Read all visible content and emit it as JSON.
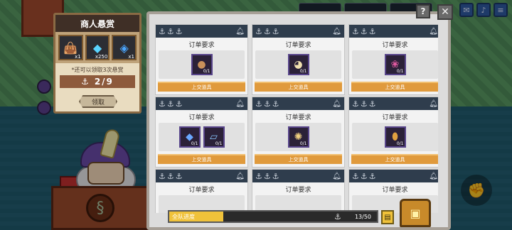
{
  "reward_panel": {
    "title": "商人悬赏",
    "items": [
      {
        "icon": "treasure-bag-icon",
        "count": "x1"
      },
      {
        "icon": "diamond-icon",
        "count": "x250"
      },
      {
        "icon": "blue-gem-icon",
        "count": "x1"
      }
    ],
    "note": "*还可以领取3次悬赏",
    "progress": "2/9",
    "claim_label": "领取"
  },
  "orders": [
    {
      "title": "订单要求",
      "items": [
        {
          "icon": "sack-icon",
          "qty": "0/1"
        }
      ],
      "submit_label": "上交道具"
    },
    {
      "title": "订单要求",
      "items": [
        {
          "icon": "food-bowl-icon",
          "qty": "0/1"
        }
      ],
      "submit_label": "上交道具"
    },
    {
      "title": "订单要求",
      "items": [
        {
          "icon": "fruit-icon",
          "qty": "0/1"
        }
      ],
      "submit_label": "上交道具"
    },
    {
      "title": "订单要求",
      "items": [
        {
          "icon": "blue-crystal-icon",
          "qty": "0/1"
        },
        {
          "icon": "blue-scroll-icon",
          "qty": "0/1"
        }
      ],
      "submit_label": "上交道具"
    },
    {
      "title": "订单要求",
      "items": [
        {
          "icon": "shell-icon",
          "qty": "0/1"
        }
      ],
      "submit_label": "上交道具"
    },
    {
      "title": "订单要求",
      "items": [
        {
          "icon": "jar-icon",
          "qty": "0/1"
        }
      ],
      "submit_label": "上交道具"
    },
    {
      "title": "订单要求",
      "items": [],
      "submit_label": ""
    },
    {
      "title": "订单要求",
      "items": [],
      "submit_label": ""
    },
    {
      "title": "订单要求",
      "items": [],
      "submit_label": ""
    }
  ],
  "team_progress": {
    "label": "全队进度",
    "count": "13/50",
    "fraction": 0.26
  },
  "colors": {
    "accent": "#e09a3c",
    "card_header": "#2f3d4d",
    "progress_fill": "#f0c23a"
  }
}
